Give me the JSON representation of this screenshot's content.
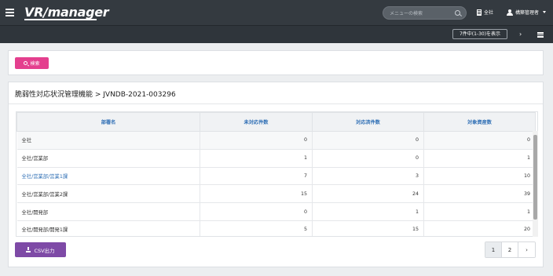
{
  "app": {
    "logo": "VR/manager"
  },
  "header": {
    "search_placeholder": "メニューの検索",
    "org_label": "全社",
    "user_label": "構築管理者"
  },
  "subbar": {
    "range_label": "7件中(1-30)を表示"
  },
  "search_panel": {
    "search_label": "検索"
  },
  "panel": {
    "title": "脆弱性対応状況管理機能 > JVNDB-2021-003296"
  },
  "table": {
    "headers": [
      "部署名",
      "未対応件数",
      "対応済件数",
      "対象資産数"
    ],
    "rows": [
      {
        "dept": "全社",
        "pending": "0",
        "done": "0",
        "assets": "0"
      },
      {
        "dept": "全社/営業部",
        "pending": "1",
        "done": "0",
        "assets": "1"
      },
      {
        "dept": "全社/営業部/営業1課",
        "pending": "7",
        "done": "3",
        "assets": "10"
      },
      {
        "dept": "全社/営業部/営業2課",
        "pending": "15",
        "done": "24",
        "assets": "39"
      },
      {
        "dept": "全社/開発部",
        "pending": "0",
        "done": "1",
        "assets": "1"
      },
      {
        "dept": "全社/開発部/開発1課",
        "pending": "5",
        "done": "15",
        "assets": "20"
      }
    ]
  },
  "footer": {
    "csv_label": "CSV出力",
    "pages": [
      "1",
      "2"
    ],
    "next_label": "›"
  },
  "colors": {
    "search_button": "#e43f8e",
    "csv_button": "#7e4aa6",
    "link": "#2f6fb5",
    "topbar": "#343a40"
  }
}
